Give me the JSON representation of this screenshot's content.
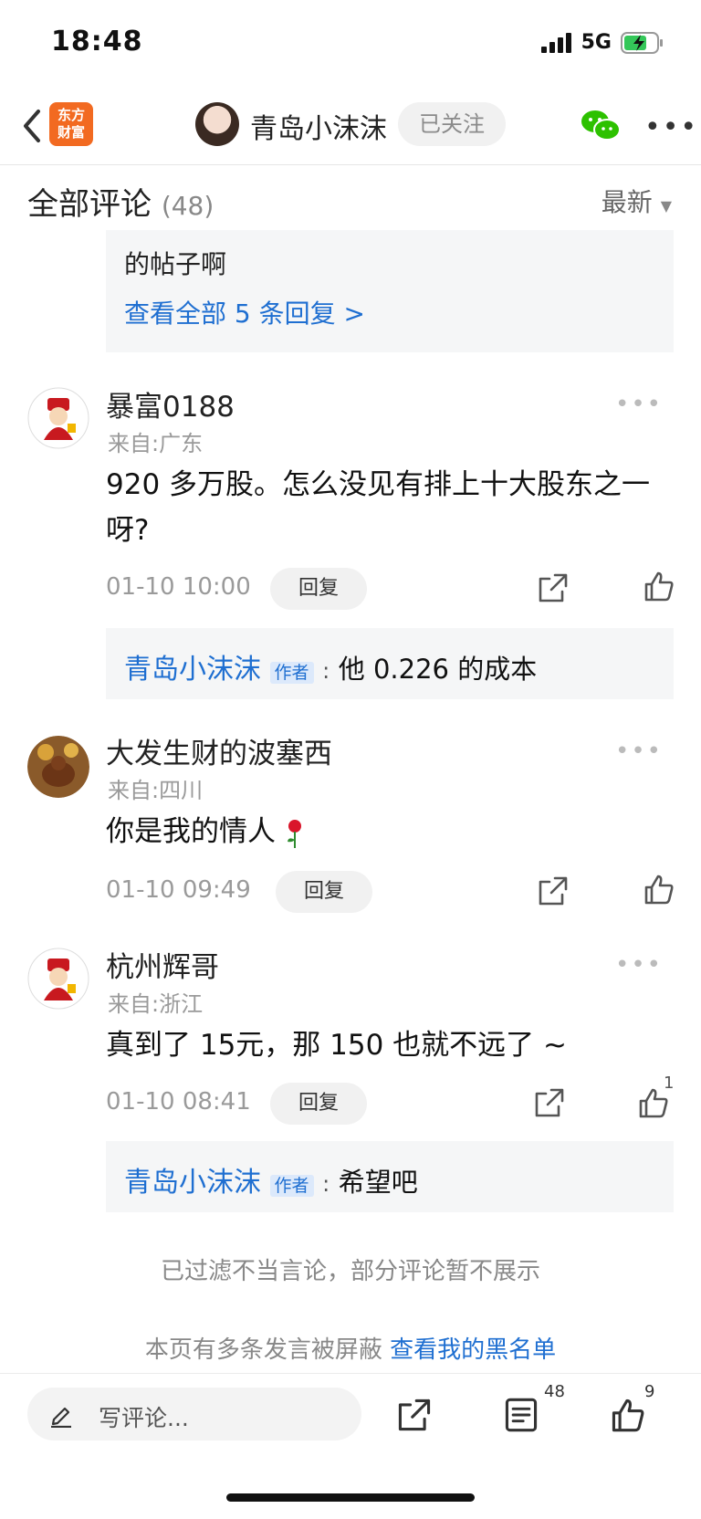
{
  "status": {
    "time": "18:48",
    "network": "5G"
  },
  "header": {
    "app_logo_line1": "东方",
    "app_logo_line2": "财富",
    "author": "青岛小沫沫",
    "follow_label": "已关注"
  },
  "section": {
    "title": "全部评论",
    "count": "(48)",
    "sort": "最新"
  },
  "top_reply": {
    "text": "的帖子啊",
    "link": "查看全部 5 条回复 >"
  },
  "comments": [
    {
      "name": "暴富0188",
      "location": "来自:广东",
      "text": "920 多万股。怎么没见有排上十大股东之一呀?",
      "time": "01-10 10:00",
      "reply_label": "回复",
      "likes": "",
      "author_reply": {
        "name": "青岛小沫沫",
        "tag": "作者",
        "colon": ":",
        "text": "他 0.226 的成本"
      }
    },
    {
      "name": "大发生财的波塞西",
      "location": "来自:四川",
      "text": "你是我的情人",
      "time": "01-10 09:49",
      "reply_label": "回复",
      "likes": ""
    },
    {
      "name": "杭州辉哥",
      "location": "来自:浙江",
      "text": "真到了 15元，那 150 也就不远了 ~",
      "time": "01-10 08:41",
      "reply_label": "回复",
      "likes": "1",
      "author_reply": {
        "name": "青岛小沫沫",
        "tag": "作者",
        "colon": ":",
        "text": "希望吧"
      }
    }
  ],
  "notices": {
    "filtered": "已过滤不当言论，部分评论暂不展示",
    "blocked_prefix": "本页有多条发言被屏蔽",
    "blocked_link": "查看我的黑名单"
  },
  "bottom": {
    "write_placeholder": "写评论...",
    "comment_count": "48",
    "like_count": "9"
  }
}
